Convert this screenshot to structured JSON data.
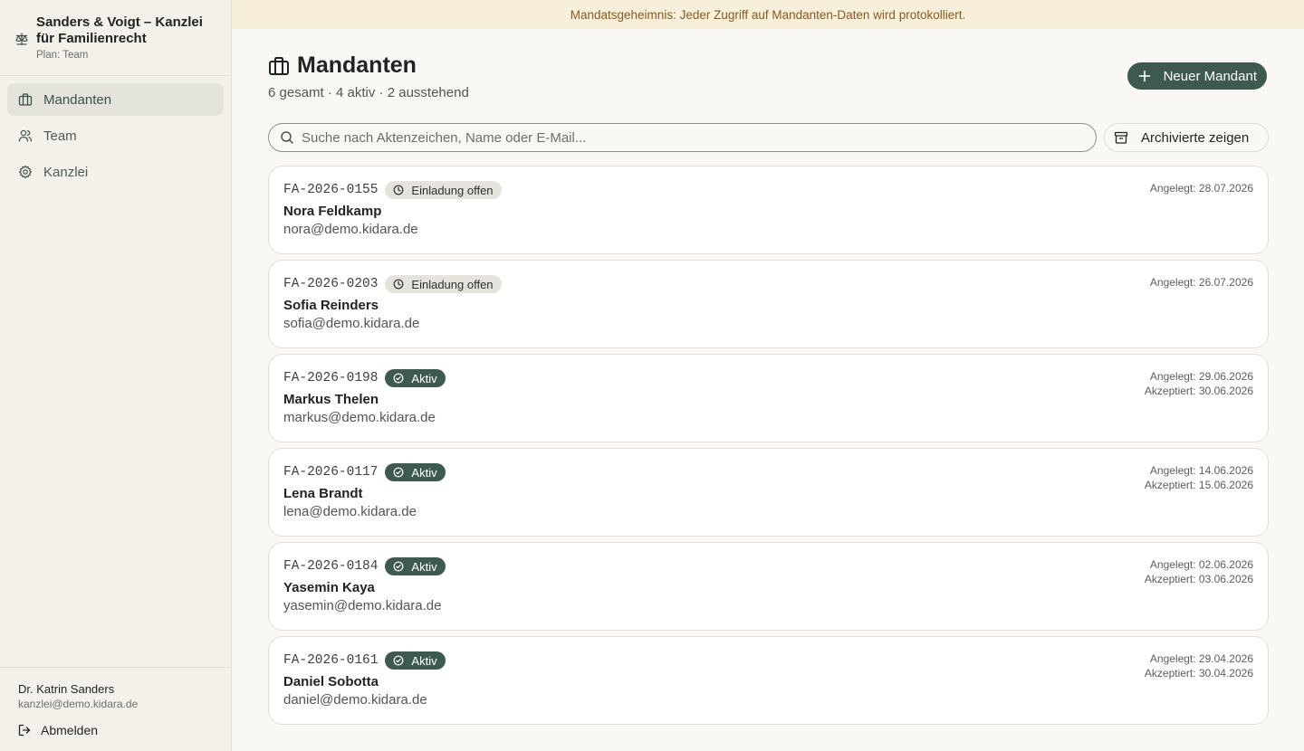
{
  "sidebar": {
    "brand": {
      "name": "Sanders & Voigt – Kanzlei für Familienrecht",
      "plan": "Plan: Team",
      "icon": "scale-icon"
    },
    "nav": [
      {
        "label": "Mandanten",
        "icon": "briefcase-icon",
        "active": true
      },
      {
        "label": "Team",
        "icon": "users-icon",
        "active": false
      },
      {
        "label": "Kanzlei",
        "icon": "gear-icon",
        "active": false
      }
    ],
    "user": {
      "name": "Dr. Katrin Sanders",
      "email": "kanzlei@demo.kidara.de"
    },
    "logout_label": "Abmelden"
  },
  "banner": {
    "text": "Mandatsgeheimnis: Jeder Zugriff auf Mandanten-Daten wird protokolliert."
  },
  "header": {
    "title": "Mandanten",
    "subtitle": "6 gesamt · 4 aktiv · 2 ausstehend",
    "new_button": "Neuer Mandant"
  },
  "search": {
    "placeholder": "Suche nach Aktenzeichen, Name oder E-Mail...",
    "value": ""
  },
  "archive_button": "Archivierte zeigen",
  "clients": [
    {
      "aktenzeichen": "FA-2026-0155",
      "status": "Einladung offen",
      "status_type": "pending",
      "name": "Nora Feldkamp",
      "email": "nora@demo.kidara.de",
      "created": "Angelegt: 28.07.2026",
      "accepted": ""
    },
    {
      "aktenzeichen": "FA-2026-0203",
      "status": "Einladung offen",
      "status_type": "pending",
      "name": "Sofia Reinders",
      "email": "sofia@demo.kidara.de",
      "created": "Angelegt: 26.07.2026",
      "accepted": ""
    },
    {
      "aktenzeichen": "FA-2026-0198",
      "status": "Aktiv",
      "status_type": "active",
      "name": "Markus Thelen",
      "email": "markus@demo.kidara.de",
      "created": "Angelegt: 29.06.2026",
      "accepted": "Akzeptiert: 30.06.2026"
    },
    {
      "aktenzeichen": "FA-2026-0117",
      "status": "Aktiv",
      "status_type": "active",
      "name": "Lena Brandt",
      "email": "lena@demo.kidara.de",
      "created": "Angelegt: 14.06.2026",
      "accepted": "Akzeptiert: 15.06.2026"
    },
    {
      "aktenzeichen": "FA-2026-0184",
      "status": "Aktiv",
      "status_type": "active",
      "name": "Yasemin Kaya",
      "email": "yasemin@demo.kidara.de",
      "created": "Angelegt: 02.06.2026",
      "accepted": "Akzeptiert: 03.06.2026"
    },
    {
      "aktenzeichen": "FA-2026-0161",
      "status": "Aktiv",
      "status_type": "active",
      "name": "Daniel Sobotta",
      "email": "daniel@demo.kidara.de",
      "created": "Angelegt: 29.04.2026",
      "accepted": "Akzeptiert: 30.04.2026"
    }
  ],
  "colors": {
    "accent": "#3e5a4f",
    "banner_bg": "#f7efd9",
    "banner_text": "#8a5a1e",
    "sidebar_bg": "#f4f1ea"
  }
}
